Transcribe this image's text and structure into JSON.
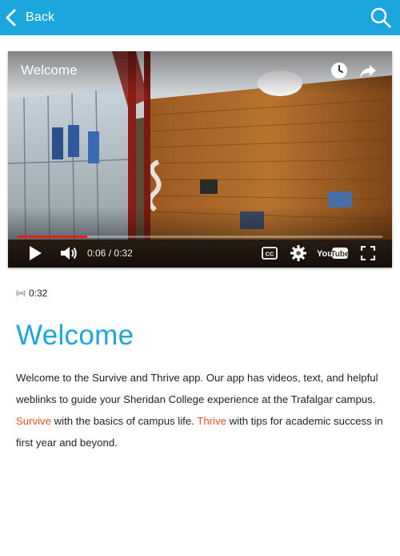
{
  "header": {
    "back_label": "Back",
    "icons": {
      "back": "chevron-left-icon",
      "search": "search-icon"
    },
    "background_color": "#1ba6dd"
  },
  "video": {
    "title": "Welcome",
    "current_time": "0:06",
    "time_separator": "/",
    "total_time": "0:32",
    "played_fraction": 0.19,
    "buffered_fraction": 0.19,
    "progress_color": "#e62117",
    "youtube_logo_text": "YouTube",
    "icons": [
      "clock-icon",
      "share-icon",
      "play-icon",
      "volume-icon",
      "closed-captions-icon",
      "gear-icon",
      "fullscreen-icon"
    ]
  },
  "duration": {
    "icon": "broadcast-icon",
    "text": "0:32"
  },
  "main": {
    "title": "Welcome",
    "title_color": "#1ba6dd",
    "highlight_color": "#e2542a",
    "paragraph": {
      "text1": "Welcome to the Survive and Thrive app. Our app has videos, text, and helpful weblinks to guide your Sheridan College experience at the Trafalgar campus. ",
      "link1": "Survive",
      "text2": " with the basics of campus life. ",
      "link2": "Thrive",
      "text3": " with tips for academic success in first year and beyond."
    }
  }
}
